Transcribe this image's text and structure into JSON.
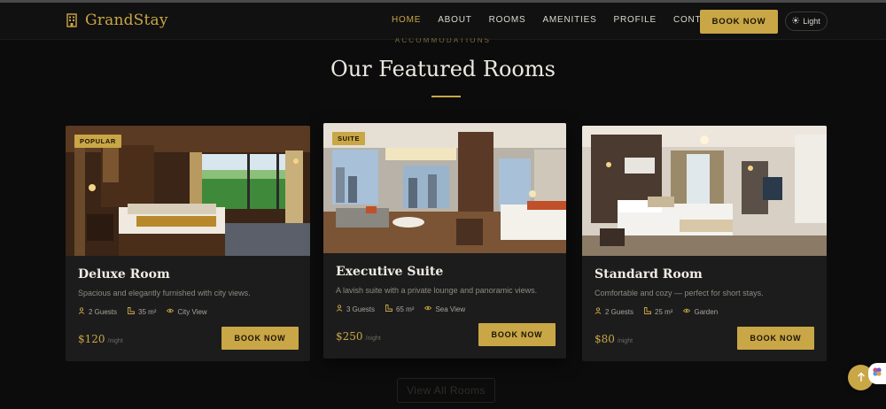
{
  "header": {
    "brand": "GrandStay",
    "nav": [
      "HOME",
      "ABOUT",
      "ROOMS",
      "AMENITIES",
      "PROFILE",
      "CONTACT"
    ],
    "active_nav": "HOME",
    "book_label": "BOOK NOW",
    "theme_label": "Light"
  },
  "section": {
    "eyebrow": "ACCOMMODATIONS",
    "title": "Our Featured Rooms"
  },
  "rooms": [
    {
      "badge": "POPULAR",
      "name": "Deluxe Room",
      "description": "Spacious and elegantly furnished with city views.",
      "guests": "2 Guests",
      "size": "35 m²",
      "view": "City View",
      "price": "$120",
      "per": "/night",
      "button": "BOOK NOW"
    },
    {
      "badge": "SUITE",
      "name": "Executive Suite",
      "description": "A lavish suite with a private lounge and panoramic views.",
      "guests": "3 Guests",
      "size": "65 m²",
      "view": "Sea View",
      "price": "$250",
      "per": "/night",
      "button": "BOOK NOW"
    },
    {
      "badge": "",
      "name": "Standard Room",
      "description": "Comfortable and cozy — perfect for short stays.",
      "guests": "2 Guests",
      "size": "25 m²",
      "view": "Garden",
      "price": "$80",
      "per": "/night",
      "button": "BOOK NOW"
    }
  ],
  "view_all_label": "View All Rooms",
  "colors": {
    "accent": "#c9a646",
    "background": "#0c0c0c",
    "card": "#1c1c1c"
  },
  "icons": {
    "logo": "hotel-building-icon",
    "theme": "sun-icon",
    "guests": "user-icon",
    "size": "ruler-icon",
    "view": "eye-icon",
    "scroll_top": "arrow-up-icon"
  }
}
